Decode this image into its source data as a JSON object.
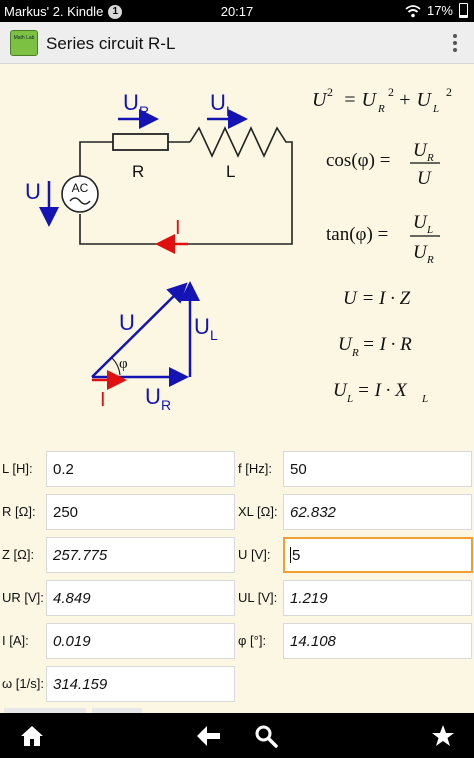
{
  "status_bar": {
    "carrier": "Markus' 2. Kindle",
    "notification_count": "1",
    "time": "20:17",
    "battery_percent": "17%",
    "battery_level": 0.17
  },
  "app_bar": {
    "icon_label": "Math Lab",
    "title": "Series circuit R-L"
  },
  "diagram": {
    "circuit": {
      "ur": "U",
      "ur_sub": "R",
      "ul": "U",
      "ul_sub": "L",
      "r": "R",
      "l": "L",
      "u": "U",
      "ac": "AC",
      "i": "I"
    },
    "phasor": {
      "u": "U",
      "ul": "U",
      "ul_sub": "L",
      "ur": "U",
      "ur_sub": "R",
      "phi": "φ",
      "i": "I"
    },
    "formulas": {
      "f1": {
        "lhs": "U",
        "exp": "2",
        "eq": "= U",
        "r": "R",
        "plus": "+ U",
        "l": "L",
        "exp2": "2",
        "exp3": "2"
      },
      "f2": {
        "lhs": "cos(φ) =",
        "num": "U",
        "num_sub": "R",
        "den": "U"
      },
      "f3": {
        "lhs": "tan(φ) =",
        "num": "U",
        "num_sub": "L",
        "den": "U",
        "den_sub": "R"
      },
      "f4": "U = I · Z",
      "f5": {
        "a": "U",
        "sub": "R",
        "b": "= I · R"
      },
      "f6": {
        "a": "U",
        "sub": "L",
        "b": "= I · X",
        "sub2": "L"
      }
    }
  },
  "fields": {
    "L": {
      "label": "L [H]:",
      "value": "0.2"
    },
    "f": {
      "label": "f [Hz]:",
      "value": "50"
    },
    "R": {
      "label": "R [Ω]:",
      "value": "250"
    },
    "XL": {
      "label": "XL [Ω]:",
      "value": "62.832"
    },
    "Z": {
      "label": "Z [Ω]:",
      "value": "257.775"
    },
    "U": {
      "label": "U [V]:",
      "value": "5"
    },
    "UR": {
      "label": "UR [V]:",
      "value": "4.849"
    },
    "UL": {
      "label": "UL [V]:",
      "value": "1.219"
    },
    "I": {
      "label": "I [A]:",
      "value": "0.019"
    },
    "phi": {
      "label": "φ [°]:",
      "value": "14.108"
    },
    "omega": {
      "label": "ω [1/s]:",
      "value": "314.159"
    }
  },
  "nav_icons": [
    "home-icon",
    "back-icon",
    "search-icon",
    "favorite-icon"
  ],
  "colors": {
    "blue": "#1414b4",
    "red": "#e01010",
    "focus": "#f0a030",
    "background": "#fbf7e3"
  }
}
